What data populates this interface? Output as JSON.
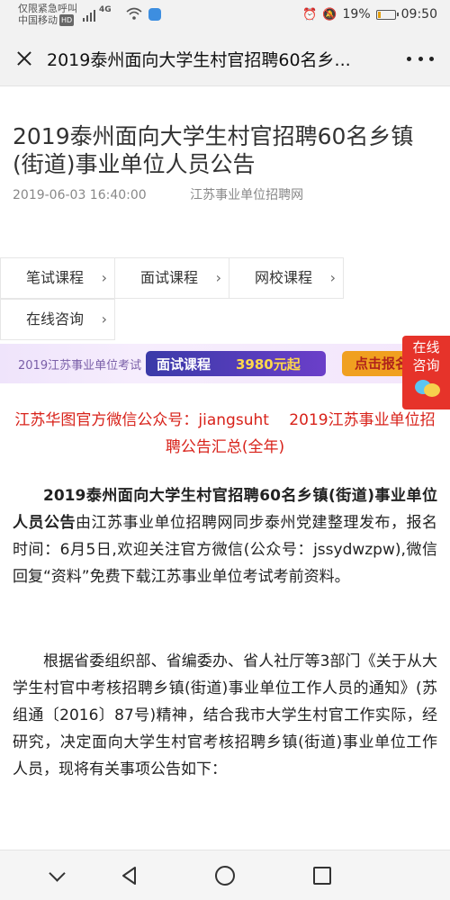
{
  "status_bar": {
    "carrier_line1": "仅限紧急呼叫",
    "carrier_line2": "中国移动",
    "hd_badge": "HD",
    "network": "4G",
    "battery_text": "19%",
    "battery_level": 0.19,
    "time": "09:50",
    "icons": [
      "signal-icon",
      "wifi-icon",
      "app-notification-icon",
      "alarm-icon",
      "mute-icon",
      "battery-icon"
    ]
  },
  "title_bar": {
    "title": "2019泰州面向大学生村官招聘60名乡...",
    "close_icon": "close-icon",
    "more_icon": "more-icon"
  },
  "article": {
    "title": "2019泰州面向大学生村官招聘60名乡镇(街道)事业单位人员公告",
    "datetime": "2019-06-03 16:40:00",
    "source": "江苏事业单位招聘网"
  },
  "courses": [
    {
      "label": "笔试课程"
    },
    {
      "label": "面试课程"
    },
    {
      "label": "网校课程"
    },
    {
      "label": "在线咨询"
    }
  ],
  "banner": {
    "left_text": "2019江苏事业单位考试",
    "pill_text": "面试课程",
    "price_text": "3980元起",
    "cta_text": "点击报名"
  },
  "float_consult": {
    "line1": "在线",
    "line2": "咨询",
    "icon": "chat-bubbles-icon"
  },
  "content": {
    "promo": "江苏华图官方微信公众号：jiangsuht　 2019江苏事业单位招聘公告汇总(全年)",
    "p1_bold": "2019泰州面向大学生村官招聘60名乡镇(街道)事业单位人员公告",
    "p1_rest": "由江苏事业单位招聘网同步泰州党建整理发布，报名时间：6月5日,欢迎关注官方微信(公众号：jssydwzpw),微信回复“资料”免费下载江苏事业单位考试考前资料。",
    "p2": "根据省委组织部、省编委办、省人社厅等3部门《关于从大学生村官中考核招聘乡镇(街道)事业单位工作人员的通知》(苏组通〔2016〕87号)精神，结合我市大学生村官工作实际，经研究，决定面向大学生村官考核招聘乡镇(街道)事业单位工作人员，现将有关事项公告如下："
  },
  "nav_bar": {
    "buttons": [
      "chevron-down-icon",
      "back-icon",
      "home-icon",
      "recents-icon"
    ]
  }
}
